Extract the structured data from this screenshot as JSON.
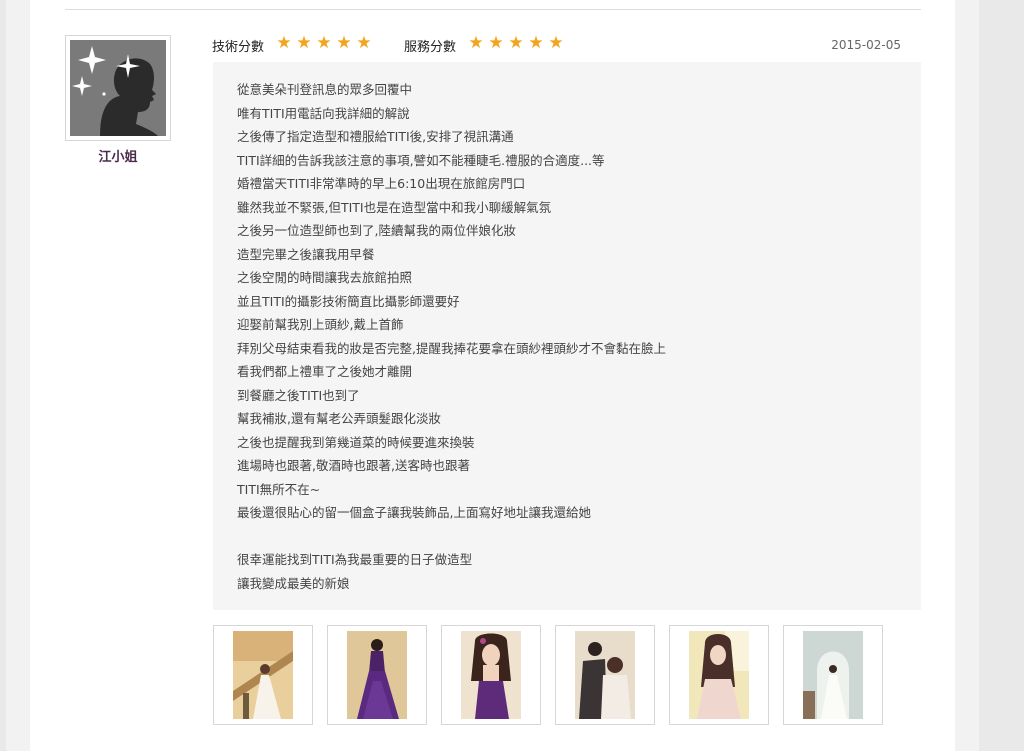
{
  "reviewer": {
    "name": "江小姐"
  },
  "ratings": [
    {
      "label": "技術分數",
      "stars": 5
    },
    {
      "label": "服務分數",
      "stars": 5
    }
  ],
  "date": "2015-02-05",
  "review_lines": [
    "從意美朵刊登訊息的眾多回覆中",
    "唯有TITI用電話向我詳細的解說",
    "之後傳了指定造型和禮服給TITI後,安排了視訊溝通",
    "TITI詳細的告訴我該注意的事項,譬如不能種睫毛.禮服的合適度...等",
    "婚禮當天TITI非常準時的早上6:10出現在旅館房門口",
    "雖然我並不緊張,但TITI也是在造型當中和我小聊緩解氣氛",
    "之後另一位造型師也到了,陸續幫我的兩位伴娘化妝",
    "造型完畢之後讓我用早餐",
    "之後空閒的時間讓我去旅館拍照",
    "並且TITI的攝影技術簡直比攝影師還要好",
    "迎娶前幫我別上頭紗,戴上首飾",
    "拜別父母結束看我的妝是否完整,提醒我捧花要拿在頭紗裡頭紗才不會黏在臉上",
    "看我們都上禮車了之後她才離開",
    "到餐廳之後TITI也到了",
    "幫我補妝,還有幫老公弄頭髮跟化淡妝",
    "之後也提醒我到第幾道菜的時候要進來換裝",
    "進場時也跟著,敬酒時也跟著,送客時也跟著",
    "TITI無所不在~",
    "最後還很貼心的留一個盒子讓我裝飾品,上面寫好地址讓我還給她",
    "",
    "很幸運能找到TITI為我最重要的日子做造型",
    "讓我變成最美的新娘"
  ],
  "photos": [
    {
      "name": "photo-bride-white-gown-staircase"
    },
    {
      "name": "photo-bride-purple-gown"
    },
    {
      "name": "photo-bride-purple-gown-closeup"
    },
    {
      "name": "photo-hairstyling-session"
    },
    {
      "name": "photo-bride-lace-dress-seated"
    },
    {
      "name": "photo-bride-white-gown-window"
    }
  ],
  "colors": {
    "star": "#f2a41c",
    "review_bg": "#f5f5f5",
    "name": "#4a2a4a"
  }
}
